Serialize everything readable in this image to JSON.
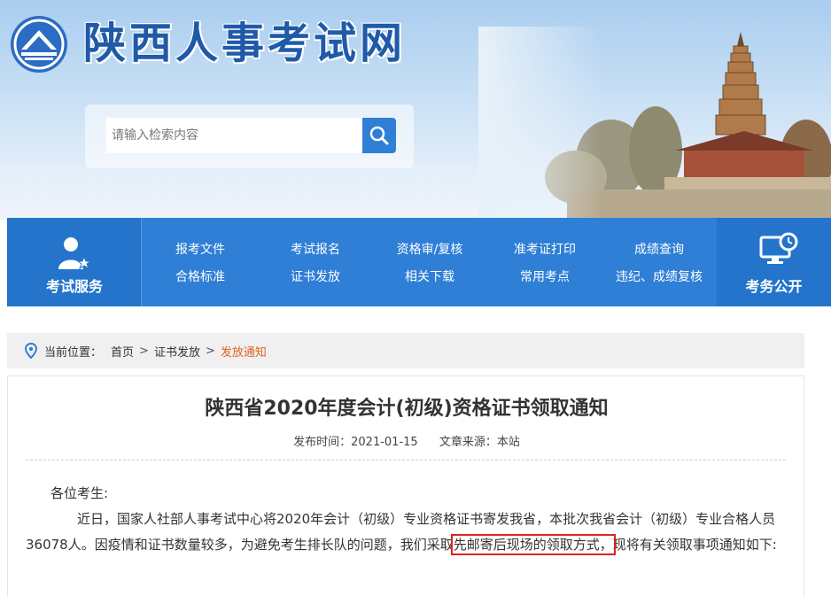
{
  "header": {
    "site_title": "陕西人事考试网",
    "search_placeholder": "请输入检索内容"
  },
  "nav": {
    "service_label": "考试服务",
    "exam_label": "考务公开",
    "links": [
      "报考文件",
      "考试报名",
      "资格审/复核",
      "准考证打印",
      "成绩查询",
      "合格标准",
      "证书发放",
      "相关下载",
      "常用考点",
      "违纪、成绩复核"
    ]
  },
  "breadcrumb": {
    "prefix": "当前位置：",
    "items": [
      "首页",
      "证书发放",
      "发放通知"
    ],
    "separator": ">"
  },
  "article": {
    "title": "陕西省2020年度会计(初级)资格证书领取通知",
    "publish_label": "发布时间：",
    "publish_date": "2021-01-15",
    "source_label": "文章来源：",
    "source": "本站",
    "salutation": "各位考生:",
    "para_part1": "近日，国家人社部人事考试中心将2020年会计（初级）专业资格证书寄发我省，本批次我省会计（初级）专业合格人员36078人。因疫情和证书数量较多，为避免考生排长队的问题，我们采取",
    "para_highlight": "先邮寄后现场的领取方式，",
    "para_part2": "现将有关领取事项通知如下:"
  },
  "colors": {
    "nav_blue": "#2f7fd6",
    "nav_dark_blue": "#2474cb",
    "title_blue": "#1f5aa8",
    "breadcrumb_current": "#e0641f",
    "highlight_red": "#e02020"
  }
}
